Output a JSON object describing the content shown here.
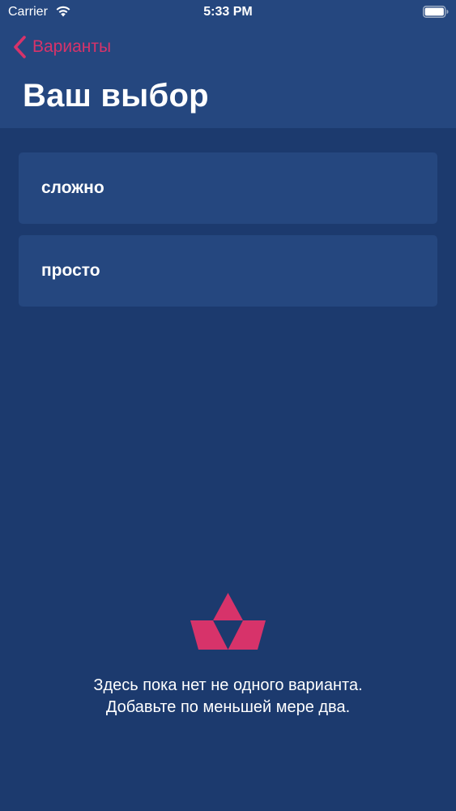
{
  "status_bar": {
    "carrier": "Carrier",
    "time": "5:33 PM",
    "wifi_icon": "wifi-icon",
    "battery_icon": "battery-icon"
  },
  "navigation": {
    "back_label": "Варианты",
    "back_icon": "chevron-left-icon",
    "title": "Ваш выбор"
  },
  "options": [
    {
      "label": "сложно"
    },
    {
      "label": "просто"
    }
  ],
  "empty_state": {
    "icon": "triangle-logo-icon",
    "message": "Здесь пока нет не одного варианта. Добавьте по меньшей мере два."
  },
  "colors": {
    "background": "#1c3a6e",
    "header": "#25477f",
    "card": "#25477f",
    "accent": "#d7336a",
    "text": "#ffffff"
  }
}
